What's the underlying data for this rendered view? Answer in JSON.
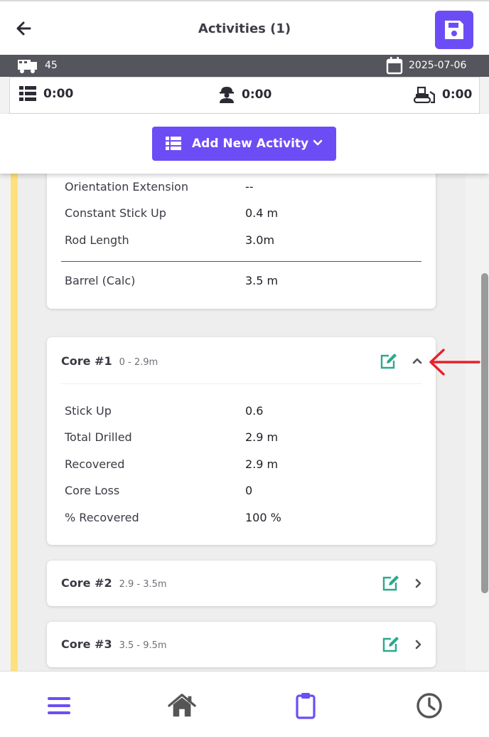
{
  "header": {
    "title": "Activities (1)"
  },
  "info": {
    "rig_number": "45",
    "date": "2025-07-06"
  },
  "hours": {
    "drilling": "0:00",
    "crew": "0:00",
    "equipment": "0:00"
  },
  "add_button": {
    "label": "Add New Activity"
  },
  "summary_card": {
    "rows": [
      {
        "label": "Orientation Extension",
        "value": "--"
      },
      {
        "label": "Constant Stick Up",
        "value": "0.4 m"
      },
      {
        "label": "Rod Length",
        "value": "3.0m"
      }
    ],
    "total": {
      "label": "Barrel (Calc)",
      "value": "3.5 m"
    }
  },
  "cores": [
    {
      "title": "Core #1",
      "range": "0 - 2.9m",
      "expanded": true,
      "rows": [
        {
          "label": "Stick Up",
          "value": "0.6"
        },
        {
          "label": "Total Drilled",
          "value": "2.9 m"
        },
        {
          "label": "Recovered",
          "value": "2.9 m"
        },
        {
          "label": "Core Loss",
          "value": "0"
        },
        {
          "label": "% Recovered",
          "value": "100 %"
        }
      ]
    },
    {
      "title": "Core #2",
      "range": "2.9 - 3.5m",
      "expanded": false
    },
    {
      "title": "Core #3",
      "range": "3.5 - 9.5m",
      "expanded": false
    }
  ],
  "nav": {
    "icons": [
      "menu-icon",
      "home-icon",
      "clipboard-icon",
      "clock-icon"
    ]
  },
  "colors": {
    "accent": "#6c4df5",
    "edit": "#2aaa8a",
    "highlight_bar": "#ffe07a",
    "annotation_arrow": "#e8202a"
  }
}
